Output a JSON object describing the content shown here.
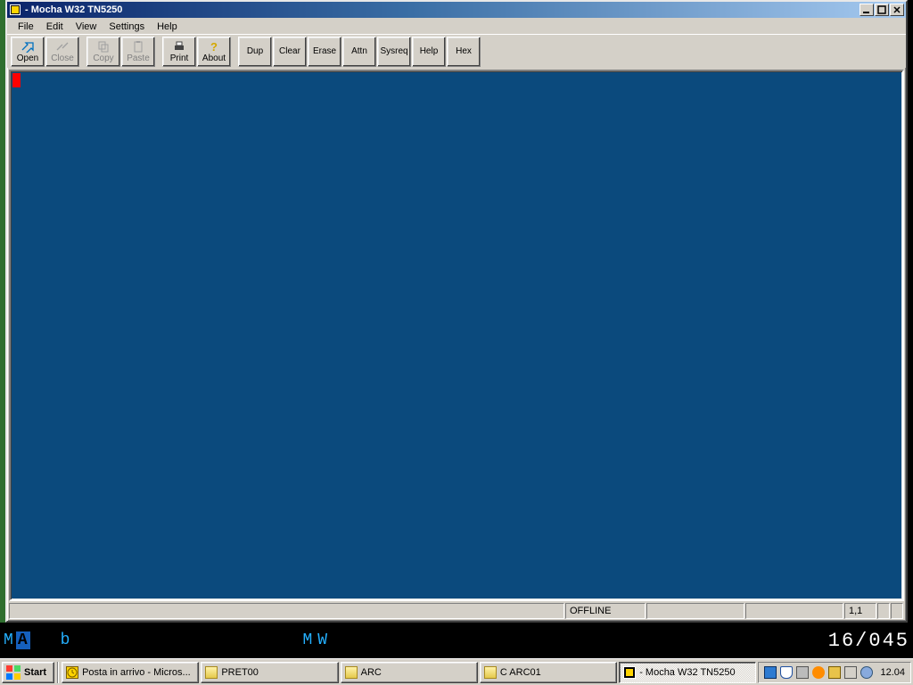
{
  "window": {
    "title": " - Mocha W32 TN5250"
  },
  "menu": {
    "items": [
      "File",
      "Edit",
      "View",
      "Settings",
      "Help"
    ]
  },
  "toolbar": {
    "open": "Open",
    "close": "Close",
    "copy": "Copy",
    "paste": "Paste",
    "print": "Print",
    "about": "About",
    "dup": "Dup",
    "clear": "Clear",
    "erase": "Erase",
    "attn": "Attn",
    "sysreq": "Sysreq",
    "help": "Help",
    "hex": "Hex"
  },
  "status": {
    "state": "OFFLINE",
    "pos": "1,1"
  },
  "indicator": {
    "ma": "MA",
    "b": "b",
    "mw": "MW",
    "rc": "16/045"
  },
  "taskbar": {
    "start": "Start",
    "tasks": [
      {
        "label": "Posta in arrivo - Micros...",
        "active": false,
        "icon": "ic-outlook"
      },
      {
        "label": "PRET00",
        "active": false,
        "icon": "ic-folder"
      },
      {
        "label": "ARC",
        "active": false,
        "icon": "ic-folder"
      },
      {
        "label": "C ARC01",
        "active": false,
        "icon": "ic-folder"
      },
      {
        "label": " - Mocha W32 TN5250",
        "active": true,
        "icon": "ic-app"
      }
    ],
    "clock": "12.04"
  }
}
